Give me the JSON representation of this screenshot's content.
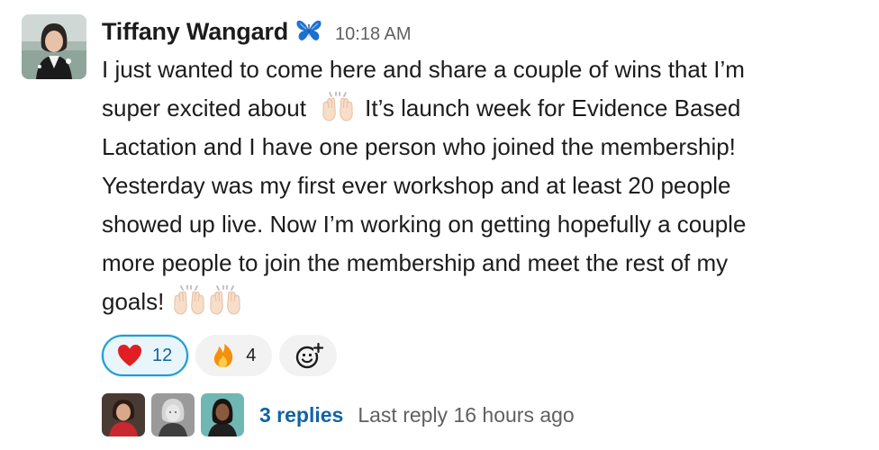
{
  "message": {
    "sender": "Tiffany Wangard",
    "status_icon": "butterfly-icon",
    "timestamp": "10:18 AM",
    "body_lines": [
      "I just wanted to come here and share a couple of wins that I’m",
      "super excited about",
      "It’s launch week for Evidence Based",
      "Lactation and I have one person who joined the membership!",
      "Yesterday was my first ever workshop and at least 20 people",
      "showed up live. Now I’m working on getting hopefully a couple",
      "more people to join the membership and meet the rest of my",
      "goals!"
    ],
    "inline_emoji": "raised-hands-emoji"
  },
  "reactions": [
    {
      "icon": "heart-emoji",
      "count": "12",
      "active": true,
      "color": "#e01e24"
    },
    {
      "icon": "fire-emoji",
      "count": "4",
      "active": false,
      "color": "#f4900c"
    }
  ],
  "add_reaction_icon": "add-reaction-icon",
  "thread": {
    "reply_count_label": "3 replies",
    "last_reply": "Last reply 16 hours ago",
    "participant_avatars": 3
  },
  "colors": {
    "link": "#1264a3",
    "muted": "#616061",
    "active_reaction_border": "#1d9bd1",
    "active_reaction_bg": "#e8f5fa",
    "reaction_bg": "#f2f2f2"
  }
}
